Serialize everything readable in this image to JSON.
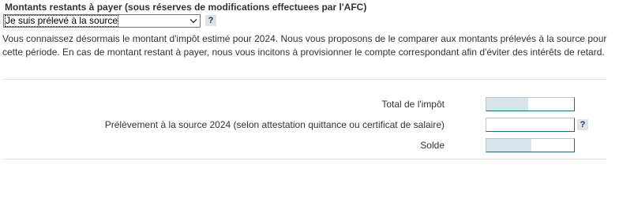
{
  "section": {
    "title": "Montants restants à payer (sous réserves de modifications effectuees par l'AFC)",
    "select": {
      "selected": "Je suis prélevé à la source"
    },
    "help": "?"
  },
  "intro_text": "Vous connaissez désormais le montant d'impôt estimé pour 2024. Nous vous proposons de le comparer aux montants prélevés à la source pour cette période. En cas de montant restant à payer, nous vous incitons à provisionner le compte correspondant afin d'éviter des intérêts de retard.",
  "rows": [
    {
      "label": "Total de l'impôt",
      "value": "",
      "fill_ratio": 0.48,
      "help": ""
    },
    {
      "label": "Prélèvement à la source 2024 (selon attestation quittance ou certificat de salaire)",
      "value": "",
      "fill_ratio": 0.0,
      "help": "?"
    },
    {
      "label": "Solde",
      "value": "",
      "fill_ratio": 0.51,
      "help": ""
    }
  ],
  "colors": {
    "field_fill": "#d8e4ea",
    "field_border_dark": "#1f6b78",
    "help_text": "#1b3a66",
    "divider": "#e3e3e3"
  }
}
